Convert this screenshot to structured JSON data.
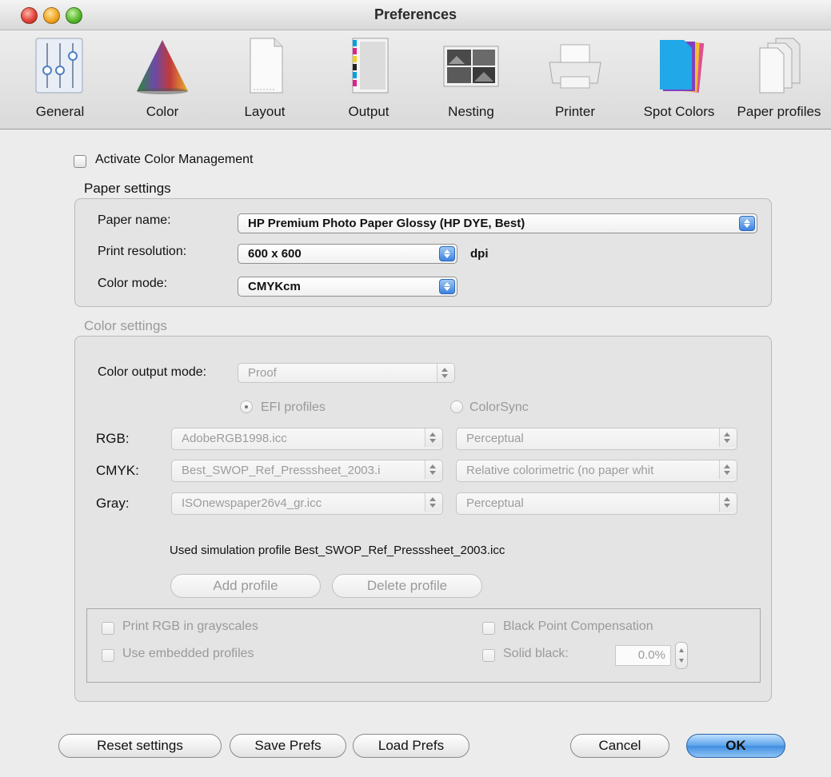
{
  "window": {
    "title": "Preferences"
  },
  "toolbar": {
    "items": [
      {
        "label": "General",
        "icon": "sliders-icon"
      },
      {
        "label": "Color",
        "icon": "color-cone-icon"
      },
      {
        "label": "Layout",
        "icon": "page-layout-icon"
      },
      {
        "label": "Output",
        "icon": "output-sheet-icon"
      },
      {
        "label": "Nesting",
        "icon": "nesting-images-icon"
      },
      {
        "label": "Printer",
        "icon": "printer-icon"
      },
      {
        "label": "Spot Colors",
        "icon": "spot-colors-icon"
      },
      {
        "label": "Paper profiles",
        "icon": "paper-profiles-icon"
      }
    ]
  },
  "activate_cm": {
    "label": "Activate Color Management",
    "checked": false
  },
  "paper_settings": {
    "title": "Paper settings",
    "paper_name_label": "Paper name:",
    "paper_name_value": "HP Premium Photo Paper Glossy (HP DYE, Best)",
    "print_resolution_label": "Print resolution:",
    "print_resolution_value": "600 x 600",
    "resolution_unit": "dpi",
    "color_mode_label": "Color mode:",
    "color_mode_value": "CMYKcm"
  },
  "color_settings": {
    "title": "Color settings",
    "output_mode_label": "Color output mode:",
    "output_mode_value": "Proof",
    "radio_efi": "EFI profiles",
    "radio_colorsync": "ColorSync",
    "selected_radio": "EFI profiles",
    "rows": [
      {
        "label": "RGB:",
        "profile": "AdobeRGB1998.icc",
        "intent": "Perceptual"
      },
      {
        "label": "CMYK:",
        "profile": "Best_SWOP_Ref_Presssheet_2003.i",
        "intent": "Relative colorimetric (no paper whit"
      },
      {
        "label": "Gray:",
        "profile": "ISOnewspaper26v4_gr.icc",
        "intent": "Perceptual"
      }
    ],
    "simulation_text": "Used simulation profile Best_SWOP_Ref_Presssheet_2003.icc",
    "add_profile": "Add profile",
    "delete_profile": "Delete profile",
    "print_rgb_gray": "Print RGB in grayscales",
    "use_embedded": "Use embedded profiles",
    "black_point": "Black Point Compensation",
    "solid_black": "Solid black:",
    "solid_black_value": "0.0%"
  },
  "footer": {
    "reset": "Reset settings",
    "save": "Save Prefs",
    "load": "Load Prefs",
    "cancel": "Cancel",
    "ok": "OK"
  },
  "colors": {
    "accent": "#3f8ee0",
    "disabled_text": "#9a9a9a"
  }
}
